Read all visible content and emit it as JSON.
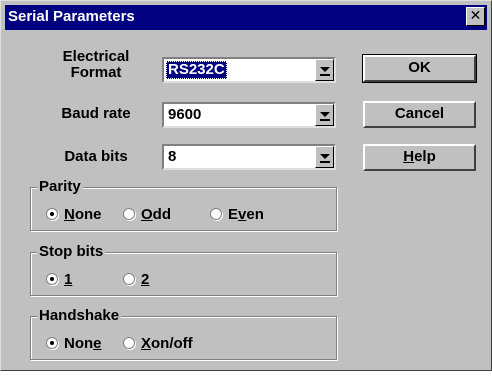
{
  "window": {
    "title": "Serial Parameters",
    "close_glyph": "✕"
  },
  "fields": {
    "electrical_format": {
      "label_line1": "Electrical",
      "label_line2": "Format",
      "value": "RS232C"
    },
    "baud_rate": {
      "label": "Baud rate",
      "value": "9600"
    },
    "data_bits": {
      "label": "Data bits",
      "value": "8"
    }
  },
  "buttons": {
    "ok": "OK",
    "cancel": "Cancel",
    "help": {
      "mnemonic": "H",
      "rest": "elp"
    }
  },
  "parity": {
    "label": "Parity",
    "options": [
      {
        "pre": "",
        "mn": "N",
        "post": "one",
        "selected": true
      },
      {
        "pre": "",
        "mn": "O",
        "post": "dd",
        "selected": false
      },
      {
        "pre": "E",
        "mn": "v",
        "post": "en",
        "selected": false
      }
    ]
  },
  "stop_bits": {
    "label": "Stop bits",
    "options": [
      {
        "pre": "",
        "mn": "1",
        "post": "",
        "selected": true
      },
      {
        "pre": "",
        "mn": "2",
        "post": "",
        "selected": false
      }
    ]
  },
  "handshake": {
    "label": "Handshake",
    "options": [
      {
        "pre": "Non",
        "mn": "e",
        "post": "",
        "selected": true
      },
      {
        "pre": "",
        "mn": "X",
        "post": "on/off",
        "selected": false
      }
    ]
  }
}
